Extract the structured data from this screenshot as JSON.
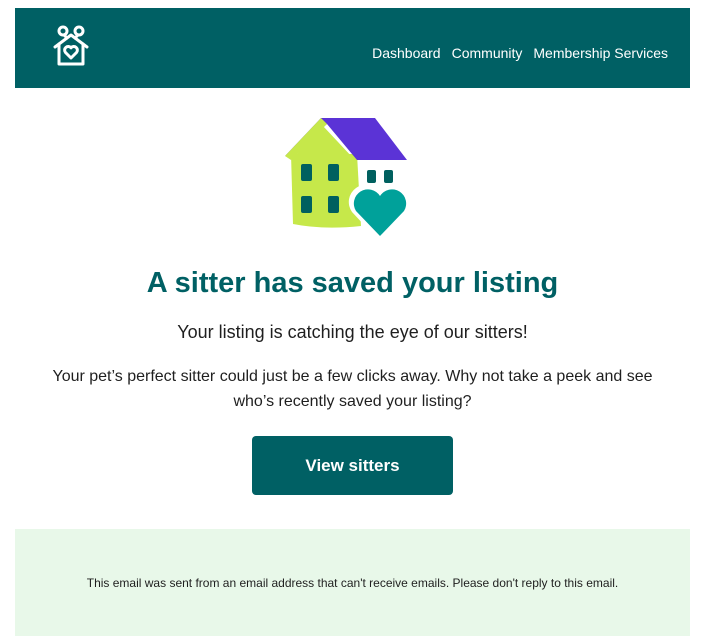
{
  "header": {
    "background_color": "#006064",
    "logo_icon": "house-heart-logo-icon",
    "nav": [
      {
        "label": "Dashboard"
      },
      {
        "label": "Community"
      },
      {
        "label": "Membership Services"
      }
    ]
  },
  "hero": {
    "illustration_icon": "house-with-heart-illustration",
    "title": "A sitter has saved your listing",
    "subtitle": "Your listing is catching the eye of our sitters!",
    "body": "Your pet’s perfect sitter could just be a few clicks away. Why not take a peek and see who’s recently saved your listing?",
    "cta_label": "View sitters",
    "accent_color": "#006064"
  },
  "footer": {
    "background_color": "#e8f8e9",
    "notice": "This email was sent from an email address that can't receive emails. Please don't reply to this email."
  }
}
